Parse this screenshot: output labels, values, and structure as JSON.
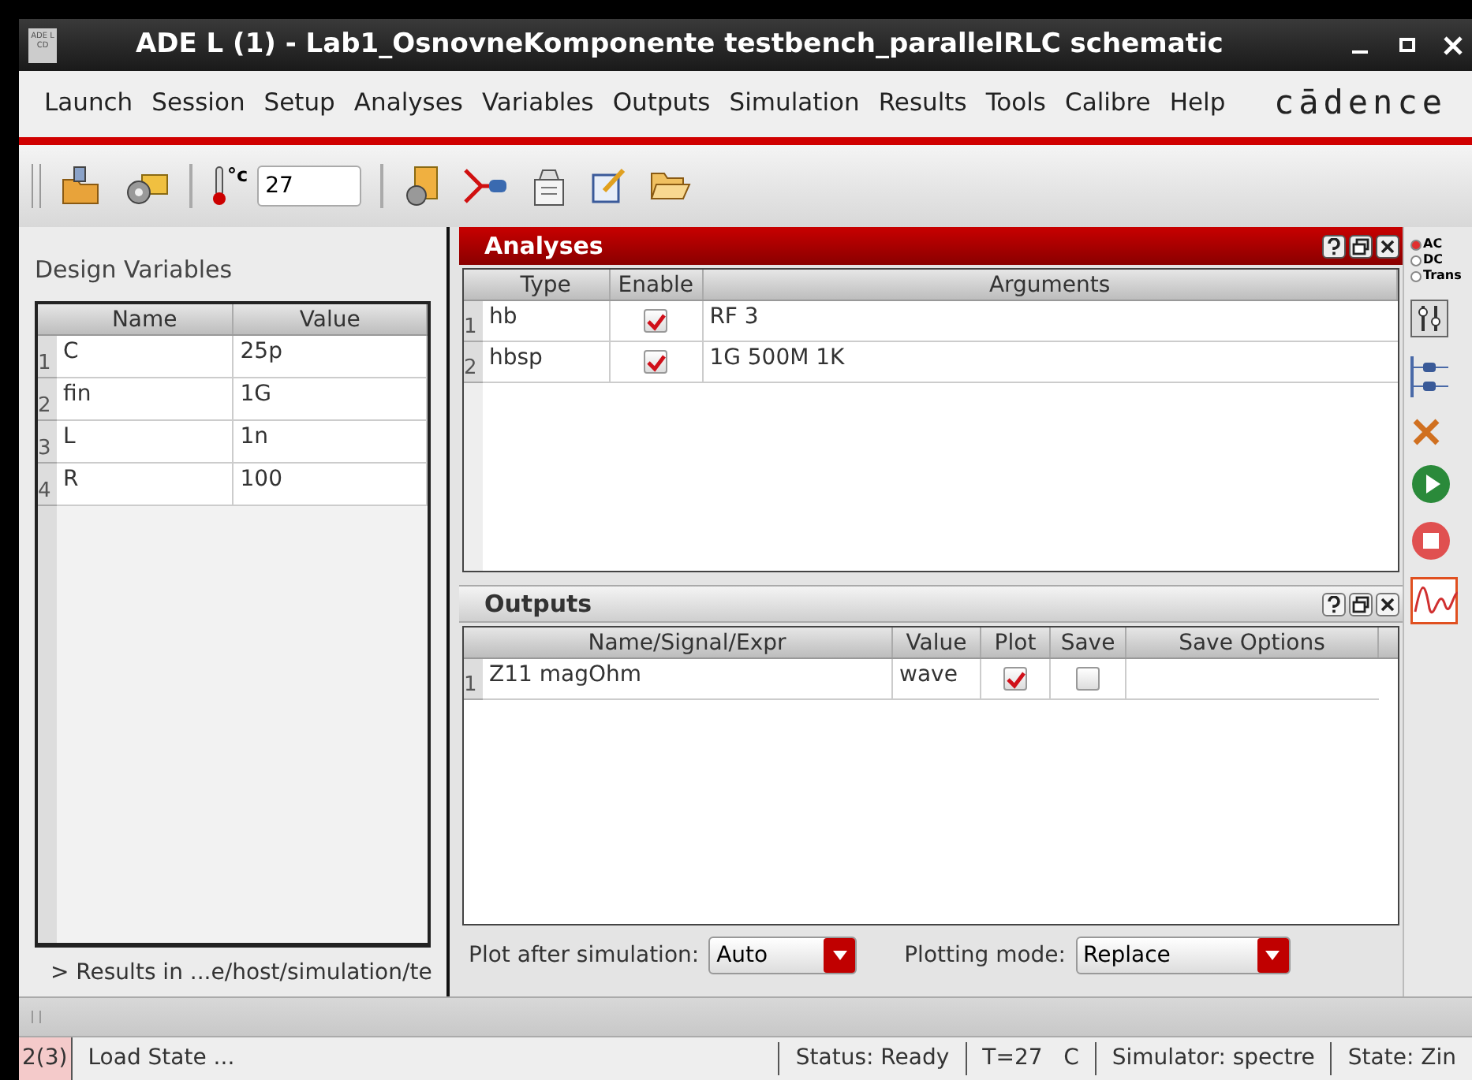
{
  "window": {
    "title": "ADE L (1) - Lab1_OsnovneKomponente testbench_parallelRLC schematic",
    "app_icon_text": "ADE L CD"
  },
  "menu": [
    {
      "label": "Launch"
    },
    {
      "label": "Session"
    },
    {
      "label": "Setup"
    },
    {
      "label": "Analyses"
    },
    {
      "label": "Variables"
    },
    {
      "label": "Outputs"
    },
    {
      "label": "Simulation"
    },
    {
      "label": "Results"
    },
    {
      "label": "Tools"
    },
    {
      "label": "Calibre"
    },
    {
      "label": "Help"
    }
  ],
  "brand": "cādence",
  "toolbar": {
    "temperature_unit": "°c",
    "temperature": "27"
  },
  "design_variables": {
    "title": "Design Variables",
    "columns": [
      "Name",
      "Value"
    ],
    "rows": [
      {
        "index": "1",
        "name": "C",
        "value": "25p"
      },
      {
        "index": "2",
        "name": "fin",
        "value": "1G"
      },
      {
        "index": "3",
        "name": "L",
        "value": "1n"
      },
      {
        "index": "4",
        "name": "R",
        "value": "100"
      }
    ],
    "results_path": "> Results in ...e/host/simulation/te"
  },
  "analyses": {
    "title": "Analyses",
    "active": true,
    "columns": [
      "Type",
      "Enable",
      "Arguments"
    ],
    "rows": [
      {
        "index": "1",
        "type": "hb",
        "enabled": true,
        "arguments": "RF 3"
      },
      {
        "index": "2",
        "type": "hbsp",
        "enabled": true,
        "arguments": "1G 500M 1K"
      }
    ]
  },
  "outputs": {
    "title": "Outputs",
    "active": false,
    "columns": [
      "Name/Signal/Expr",
      "Value",
      "Plot",
      "Save",
      "Save Options"
    ],
    "rows": [
      {
        "index": "1",
        "name": "Z11 magOhm",
        "value": "wave",
        "plot": true,
        "save": false
      }
    ],
    "plot_after_label": "Plot after simulation:",
    "plot_after": "Auto",
    "plotting_mode_label": "Plotting mode:",
    "plotting_mode": "Replace"
  },
  "analysis_type": [
    {
      "label": "AC",
      "selected": true
    },
    {
      "label": "DC",
      "selected": false
    },
    {
      "label": "Trans",
      "selected": false
    }
  ],
  "status_bar": {
    "history": "2(3)",
    "message": "Load State ...",
    "status": "Status: Ready",
    "temperature": "T=27   C",
    "simulator": "Simulator: spectre",
    "state": "State: Zin"
  }
}
